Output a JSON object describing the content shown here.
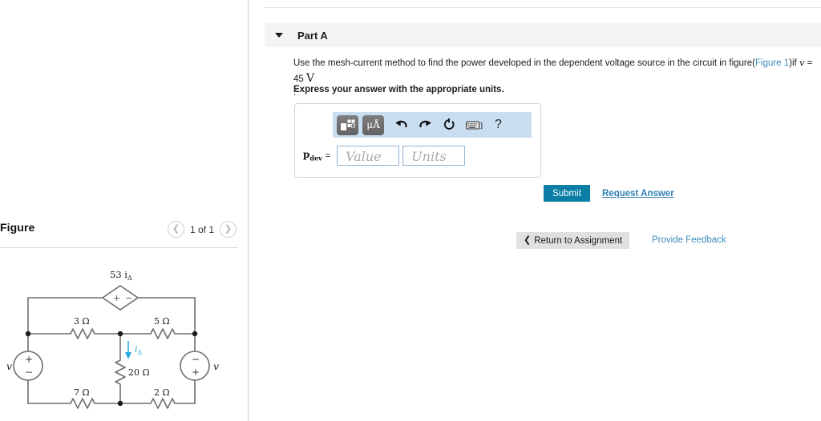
{
  "figure_panel": {
    "title": "Figure",
    "prev_icon": "chevron-left-icon",
    "next_icon": "chevron-right-icon",
    "count_label": "1 of 1"
  },
  "circuit": {
    "dependent_source_label": "53 i",
    "dependent_source_sub": "Δ",
    "dependent_source_plus": "+",
    "dependent_source_minus": "−",
    "resistors": [
      {
        "label": "3 Ω"
      },
      {
        "label": "5 Ω"
      },
      {
        "label": "20 Ω"
      },
      {
        "label": "7 Ω"
      },
      {
        "label": "2 Ω"
      }
    ],
    "current_label": "i",
    "current_sub": "Δ",
    "current_color": "#29a8df",
    "left_source": {
      "label": "v",
      "top_sign": "+",
      "bottom_sign": "−"
    },
    "right_source": {
      "label": "v",
      "top_sign": "−",
      "bottom_sign": "+"
    }
  },
  "part": {
    "caret_icon": "caret-down-icon",
    "label": "Part A",
    "question_pre": "Use the mesh-current method to find the power developed in the dependent voltage source in the circuit in figure(",
    "question_link": "Figure 1",
    "question_mid": ")if ",
    "question_var": "v",
    "question_value": " = 45 ",
    "question_unit": "V",
    "question_post": ".",
    "instruction": "Express your answer with the appropriate units."
  },
  "answer": {
    "toolbar": {
      "template_icon": "math-template-icon",
      "units_icon": "micro-angstrom-units-icon",
      "units_text": "μÅ",
      "undo_icon": "undo-arrow-icon",
      "redo_icon": "redo-arrow-icon",
      "reset_icon": "reset-circular-arrow-icon",
      "keyboard_icon": "keyboard-icon",
      "help_icon": "question-mark-icon",
      "help_label": "?"
    },
    "variable": "p",
    "variable_sub": "dev",
    "equals": "=",
    "value_placeholder": "Value",
    "units_placeholder": "Units",
    "submit_label": "Submit",
    "request_answer_label": "Request Answer"
  },
  "footer": {
    "return_icon": "chevron-left-icon",
    "return_label": "Return to Assignment",
    "feedback_label": "Provide Feedback"
  },
  "colors": {
    "accent_blue": "#0a7ea4",
    "link_blue": "#3b8bbd",
    "toolbar_blue": "#cadef2",
    "current_cyan": "#29a8df"
  }
}
